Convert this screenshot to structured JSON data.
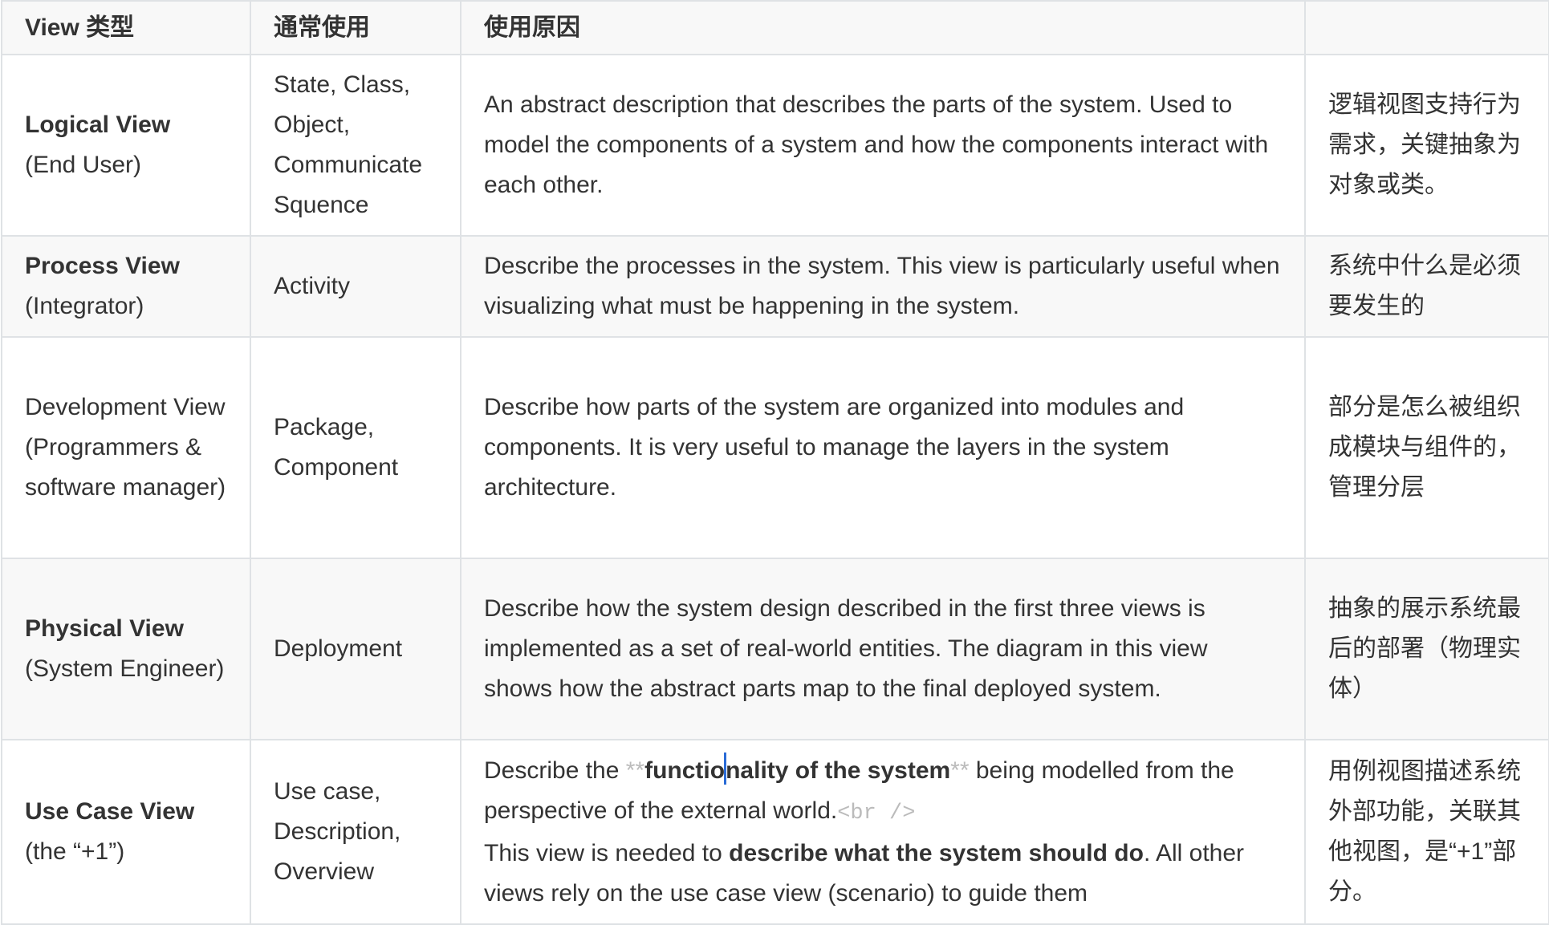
{
  "headers": [
    "View 类型",
    "通常使用",
    "使用原因",
    ""
  ],
  "rows": [
    {
      "name": "Logical View",
      "role": "(End User)",
      "usage": "State, Class, Object, Communicate Squence",
      "reason": "An abstract description that describes the parts of the system. Used to model the components of a system and how the components interact with each other.",
      "note": "逻辑视图支持行为需求，关键抽象为对象或类。"
    },
    {
      "name": "Process View",
      "role": "(Integrator)",
      "usage": "Activity",
      "reason": "Describe the processes in the system. This view is particularly useful when visualizing what must be happening in the system.",
      "note": "系统中什么是必须要发生的"
    },
    {
      "name": "Development View (Programmers & software manager)",
      "usage": "Package, Component",
      "reason": "Describe how parts of the system are organized into modules and components. It is very useful to manage the layers in the system architecture.",
      "note": "部分是怎么被组织成模块与组件的，管理分层"
    },
    {
      "name": "Physical View",
      "role": "(System Engineer)",
      "usage": "Deployment",
      "reason": "Describe how the system design described in the first three views is implemented as a set of real-world entities. The diagram in this view shows how the abstract parts map to the final deployed system.",
      "note": "抽象的展示系统最后的部署（物理实体）"
    },
    {
      "name": "Use Case View",
      "role": "(the “+1”)",
      "usage": "Use case, Description, Overview",
      "reason": {
        "p1": "Describe the ",
        "md1": "**",
        "b1a": "functio",
        "b1b": "nality of the system",
        "md2": "**",
        "p2": " being modelled from the perspective of the external world.",
        "br": "<br />",
        "p3": "This view is needed to ",
        "b2": "describe what the system should do",
        "p4": ". All other views rely on the use case view (scenario) to guide them"
      },
      "note": "用例视图描述系统外部功能，关联其他视图，是“+1”部分。"
    }
  ]
}
